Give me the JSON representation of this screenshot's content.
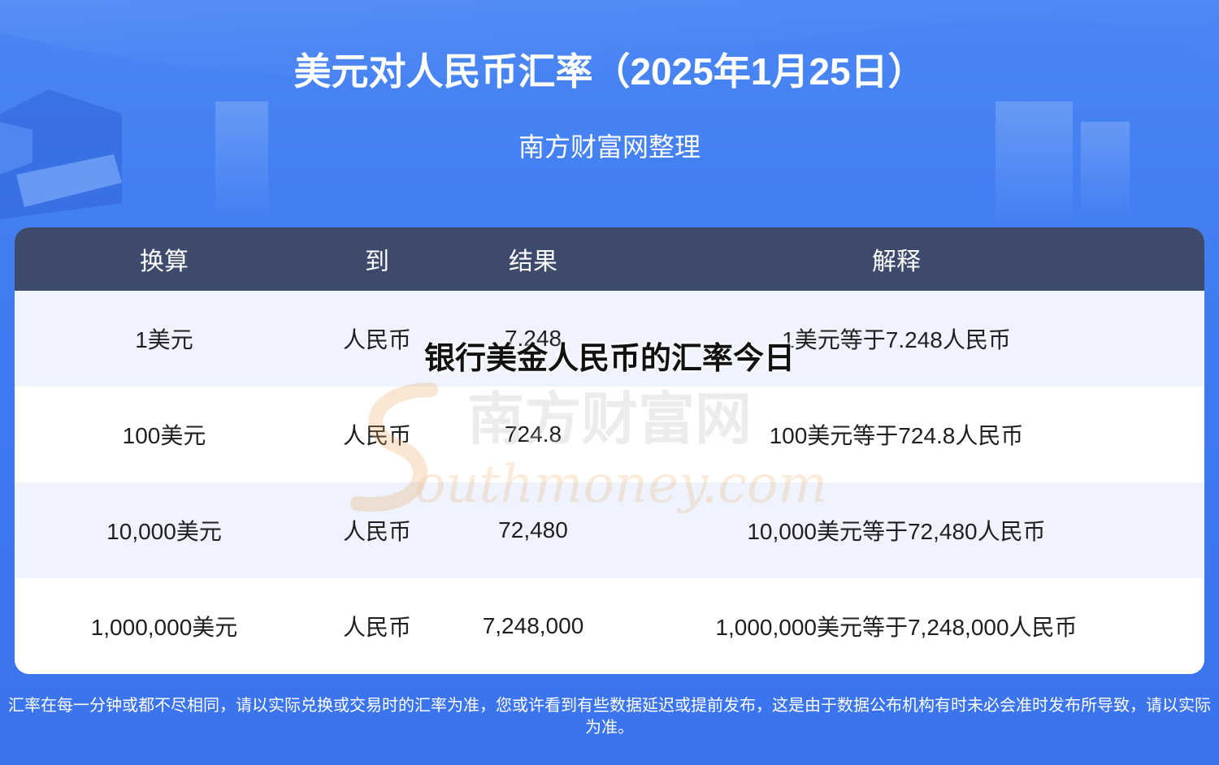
{
  "header": {
    "title": "美元对人民币汇率（2025年1月25日）",
    "subtitle": "南方财富网整理"
  },
  "table": {
    "columns": [
      "换算",
      "到",
      "结果",
      "解释"
    ],
    "rows": [
      {
        "from": "1美元",
        "to": "人民币",
        "result": "7.248",
        "explain": "1美元等于7.248人民币"
      },
      {
        "from": "100美元",
        "to": "人民币",
        "result": "724.8",
        "explain": "100美元等于724.8人民币"
      },
      {
        "from": "10,000美元",
        "to": "人民币",
        "result": "72,480",
        "explain": "10,000美元等于72,480人民币"
      },
      {
        "from": "1,000,000美元",
        "to": "人民币",
        "result": "7,248,000",
        "explain": "1,000,000美元等于7,248,000人民币"
      }
    ]
  },
  "overlay": {
    "caption": "银行美金人民币的汇率今日"
  },
  "watermark": {
    "cn": "南方财富网",
    "en": "outhmoney.com"
  },
  "footer": {
    "note": "汇率在每一分钟或都不尽相同，请以实际兑换或交易时的汇率为准，您或许看到有些数据延迟或提前发布，这是由于数据公布机构有时未必会准时发布所导致，请以实际为准。"
  },
  "colors": {
    "background": "#3f7cf2",
    "table_header": "#3d4a6b",
    "row_alt": "#eef3fd",
    "watermark": "#e9a860"
  }
}
